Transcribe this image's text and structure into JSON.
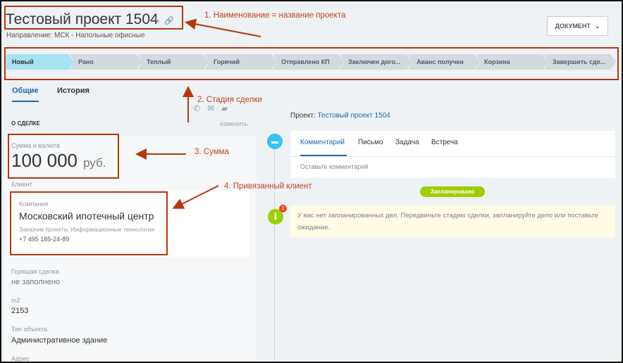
{
  "header": {
    "title": "Тестовый проект 1504",
    "edit_icon": "pencil-icon",
    "link_icon": "link-icon",
    "subtitle": "Направление: МСК - Напольные офисные",
    "document_button": "ДОКУМЕНТ"
  },
  "stages": [
    {
      "label": "Новый",
      "active": true
    },
    {
      "label": "Рано",
      "active": false
    },
    {
      "label": "Теплый",
      "active": false
    },
    {
      "label": "Горячий",
      "active": false
    },
    {
      "label": "Отправлено КП",
      "active": false
    },
    {
      "label": "Заключен дого...",
      "active": false
    },
    {
      "label": "Аванс получен",
      "active": false
    },
    {
      "label": "Корзина",
      "active": false
    },
    {
      "label": "Завершить сде...",
      "active": false
    }
  ],
  "tabs": {
    "general": "Общие",
    "history": "История"
  },
  "deal": {
    "section_title": "О СДЕЛКЕ",
    "change": "изменить",
    "amount_label": "Сумма и валюта",
    "amount": "100 000",
    "currency": "руб.",
    "client_label": "Клиент",
    "company_label": "Компания",
    "company_name": "Московский ипотечный центр",
    "company_desc": "Заказчик проекта, Информационные технологии",
    "company_phone": "+7 495 185-24-89",
    "fields": [
      {
        "label": "Горящая сделка",
        "value": "не заполнено"
      },
      {
        "label": "m2",
        "value": "2153"
      },
      {
        "label": "Тип объекта",
        "value": "Административное здание"
      },
      {
        "label": "Адрес",
        "value": ""
      }
    ]
  },
  "feed": {
    "project_prefix": "Проект:",
    "project_link": "Тестовый проект 1504",
    "tabs": [
      "Комментарий",
      "Письмо",
      "Задача",
      "Встреча"
    ],
    "comment_placeholder": "Оставьте комментарий",
    "planned_badge": "Запланировано",
    "info_count": "1",
    "notice": "У вас нет запланированных дел. Передвиньте стадию сделки, запланируйте дело или поставьте ожидание."
  },
  "annotations": {
    "a1": "1. Наименование = название проекта",
    "a2": "2. Стадия сделки",
    "a3": "3. Сумма",
    "a4": "4. Привязанный клиент"
  },
  "colors": {
    "annotation": "#c1441d",
    "link": "#2067b0",
    "active_stage": "#a8e2f5",
    "accent_green": "#9dcf00"
  }
}
